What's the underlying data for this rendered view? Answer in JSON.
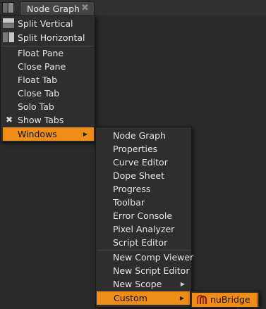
{
  "tabbar": {
    "tab_label": "Node Graph",
    "tab_close_icon": "✖"
  },
  "pane_menu": {
    "items": [
      {
        "label": "Split Vertical"
      },
      {
        "label": "Split Horizontal"
      },
      {
        "label": "Float Pane"
      },
      {
        "label": "Close Pane"
      },
      {
        "label": "Float Tab"
      },
      {
        "label": "Close Tab"
      },
      {
        "label": "Solo Tab"
      },
      {
        "label": "Show Tabs",
        "checked_icon": "✖"
      },
      {
        "label": "Windows"
      }
    ]
  },
  "windows_menu": {
    "items": [
      {
        "label": "Node Graph"
      },
      {
        "label": "Properties"
      },
      {
        "label": "Curve Editor"
      },
      {
        "label": "Dope Sheet"
      },
      {
        "label": "Progress"
      },
      {
        "label": "Toolbar"
      },
      {
        "label": "Error Console"
      },
      {
        "label": "Pixel Analyzer"
      },
      {
        "label": "Script Editor"
      },
      {
        "label": "New Comp Viewer"
      },
      {
        "label": "New Script Editor"
      },
      {
        "label": "New Scope"
      },
      {
        "label": "Custom"
      }
    ]
  },
  "custom_menu": {
    "items": [
      {
        "label": "nuBridge",
        "icon": "nubridge-logo-icon"
      }
    ]
  },
  "colors": {
    "highlight": "#f08d19",
    "menu_bg": "#2e2e2e",
    "background": "#2b2b2b"
  }
}
